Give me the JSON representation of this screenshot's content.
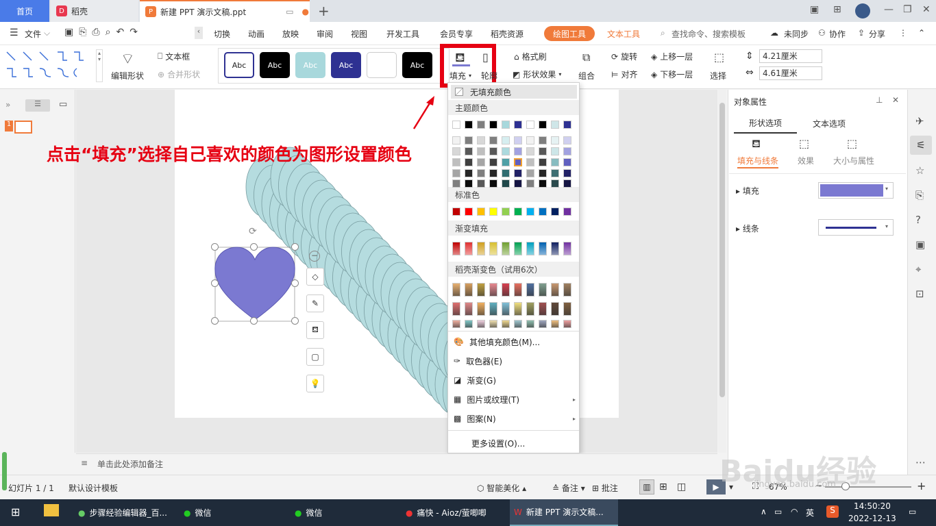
{
  "tabs": {
    "home": "首页",
    "daoke": "稻壳",
    "doc": "新建 PPT 演示文稿.ppt",
    "add": "+"
  },
  "menu": {
    "file": "文件",
    "items": [
      "切换",
      "动画",
      "放映",
      "审阅",
      "视图",
      "开发工具",
      "会员专享",
      "稻壳资源"
    ],
    "drawing_tools": "绘图工具",
    "text_tools": "文本工具",
    "search": "查找命令、搜索模板",
    "unsync": "未同步",
    "collab": "协作",
    "share": "分享"
  },
  "ribbon": {
    "edit_shape": "编辑形状",
    "text_box": "文本框",
    "merge_shape": "合并形状",
    "style_labels": [
      "Abc",
      "Abc",
      "Abc",
      "Abc",
      "",
      "Abc"
    ],
    "fill": "填充",
    "outline": "轮廓",
    "format_brush": "格式刷",
    "shape_effect": "形状效果",
    "combine": "组合",
    "rotate": "旋转",
    "align": "对齐",
    "bring_forward": "上移一层",
    "send_backward": "下移一层",
    "select": "选择",
    "width": "4.21厘米",
    "height": "4.61厘米"
  },
  "annotation": "点击“填充”选择自己喜欢的颜色为图形设置颜色",
  "dropdown": {
    "no_fill": "无填充颜色",
    "theme_colors": "主题颜色",
    "standard": "标准色",
    "gradient": "渐变填充",
    "daoke_gradient": "稻壳渐变色（试用6次）",
    "more_fill": "其他填充颜色(M)...",
    "eyedropper": "取色器(E)",
    "gradient_item": "渐变(G)",
    "picture": "图片或纹理(T)",
    "pattern": "图案(N)",
    "more_settings": "更多设置(O)...",
    "theme_top": [
      "#ffffff",
      "#000000",
      "#7f7f7f",
      "#000000",
      "#a8d8dc",
      "#2e3192",
      "#ffffff",
      "#000000",
      "#cfe6e8",
      "#2e3192"
    ],
    "standard_colors": [
      "#c00000",
      "#ff0000",
      "#ffc000",
      "#ffff00",
      "#92d050",
      "#00b050",
      "#00b0f0",
      "#0070c0",
      "#002060",
      "#7030a0"
    ],
    "gradient_colors": [
      "#c00000",
      "#e03030",
      "#d0a020",
      "#d8c030",
      "#70a030",
      "#00a050",
      "#00a0c0",
      "#0060b0",
      "#102060",
      "#7030a0"
    ]
  },
  "right_pane": {
    "title": "对象属性",
    "tab_shape": "形状选项",
    "tab_text": "文本选项",
    "sub_fill": "填充与线条",
    "sub_effect": "效果",
    "sub_size": "大小与属性",
    "fill": "填充",
    "line": "线条",
    "fill_color": "#7b79d1"
  },
  "notes": "单击此处添加备注",
  "status": {
    "slide": "幻灯片 1 / 1",
    "template": "默认设计模板",
    "smart": "智能美化",
    "notes": "备注",
    "comment": "批注",
    "zoom": "67%"
  },
  "taskbar": {
    "items": [
      "步骤经验编辑器_百...",
      "微信",
      "微信",
      "痛快 - Aioz/萤唧唧",
      "新建 PPT 演示文稿..."
    ],
    "ime": "英",
    "time": "14:50:20",
    "date": "2022-12-13"
  },
  "watermark": "Baidu经验",
  "watermark_url": "jingyan.baidu.com",
  "slide_thumb_num": "1"
}
